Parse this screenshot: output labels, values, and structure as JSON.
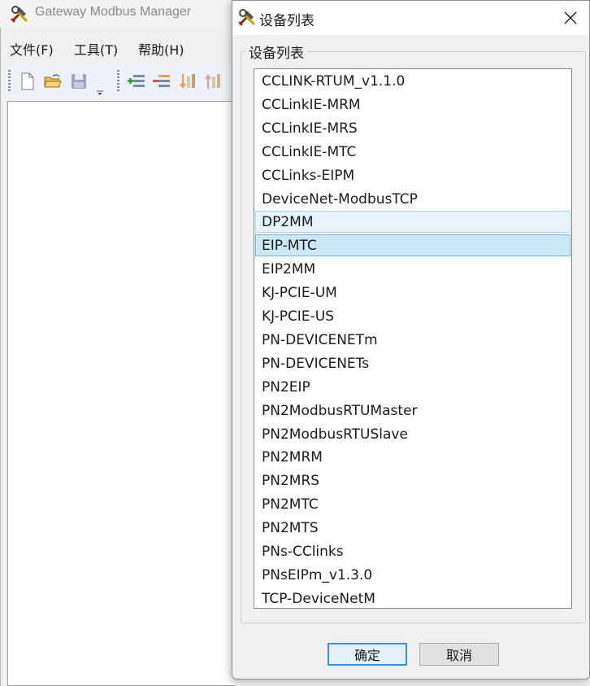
{
  "main_window": {
    "title": "Gateway Modbus Manager",
    "menu": [
      {
        "label": "文件(F)"
      },
      {
        "label": "工具(T)"
      },
      {
        "label": "帮助(H)"
      }
    ],
    "toolbar_icons": [
      "new-file-icon",
      "open-folder-icon",
      "save-icon",
      "dropdown-arrow-icon",
      "add-row-icon",
      "remove-row-icon",
      "import-icon",
      "export-icon"
    ]
  },
  "dialog": {
    "title": "设备列表",
    "group_label": "设备列表",
    "devices": [
      "CCLINK-RTUM_v1.1.0",
      "CCLinkIE-MRM",
      "CCLinkIE-MRS",
      "CCLinkIE-MTC",
      "CCLinks-EIPM",
      "DeviceNet-ModbusTCP",
      "DP2MM",
      "EIP-MTC",
      "EIP2MM",
      "KJ-PCIE-UM",
      "KJ-PCIE-US",
      "PN-DEVICENETm",
      "PN-DEVICENETs",
      "PN2EIP",
      "PN2ModbusRTUMaster",
      "PN2ModbusRTUSlave",
      "PN2MRM",
      "PN2MRS",
      "PN2MTC",
      "PN2MTS",
      "PNs-CClinks",
      "PNsEIPm_v1.3.0",
      "TCP-DeviceNetM"
    ],
    "hovered_device": "DP2MM",
    "selected_device": "EIP-MTC",
    "ok_label": "确定",
    "cancel_label": "取消"
  },
  "colors": {
    "selection": "#cce8f7",
    "hover": "#e5f3fb",
    "accent": "#3c8fd8"
  }
}
